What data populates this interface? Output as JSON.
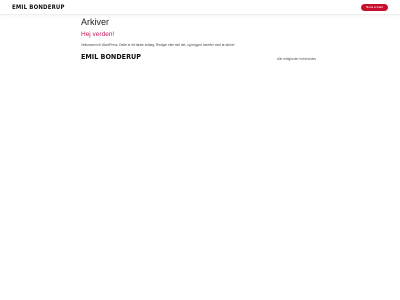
{
  "header": {
    "brand": "EMIL BONDERUP",
    "cta_label": "Book et kald",
    "cta_color": "#c8102e"
  },
  "main": {
    "archive_title": "Arkiver",
    "posts": [
      {
        "title": "Hej verden!",
        "excerpt": "Velkommen til WordPress. Dette er dit første indlæg. Redigér eller slet det, og begynd herefter med at skrive!"
      }
    ],
    "link_color": "#c2185b"
  },
  "footer": {
    "brand": "EMIL BONDERUP",
    "copyright": "Alle rettigheder forbeholdes"
  }
}
